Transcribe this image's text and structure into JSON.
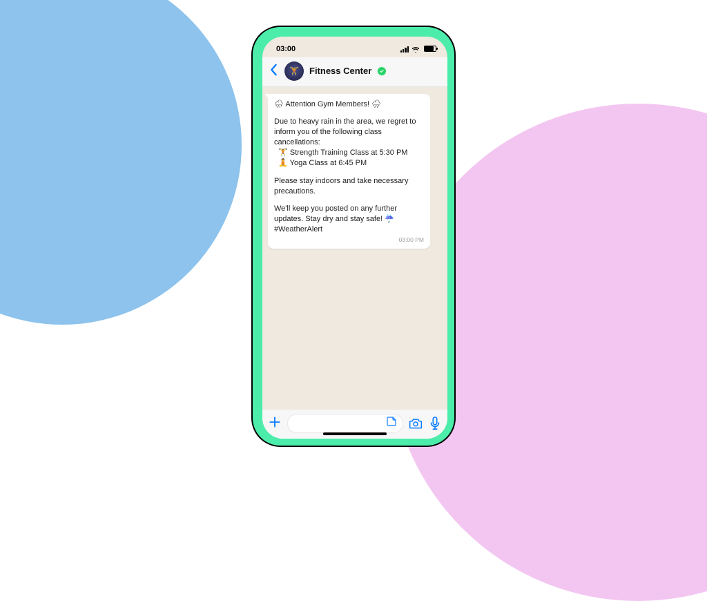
{
  "statusbar": {
    "time": "03:00"
  },
  "header": {
    "name": "Fitness Center",
    "avatar_emoji": "🏋️"
  },
  "message": {
    "line_attention": "🌧 Attention Gym Members! 🌧",
    "line_intro": "Due to heavy rain in the area, we regret to inform you of the following class cancellations:",
    "line_class1": "🏋️ Strength Training Class at 5:30 PM",
    "line_class2": "🧘 Yoga Class at 6:45 PM",
    "line_precaution": "Please stay indoors and take necessary precautions.",
    "line_closing": "We'll keep you posted on any further updates. Stay dry and stay safe! ☔ #WeatherAlert",
    "timestamp": "03:00 PM"
  }
}
